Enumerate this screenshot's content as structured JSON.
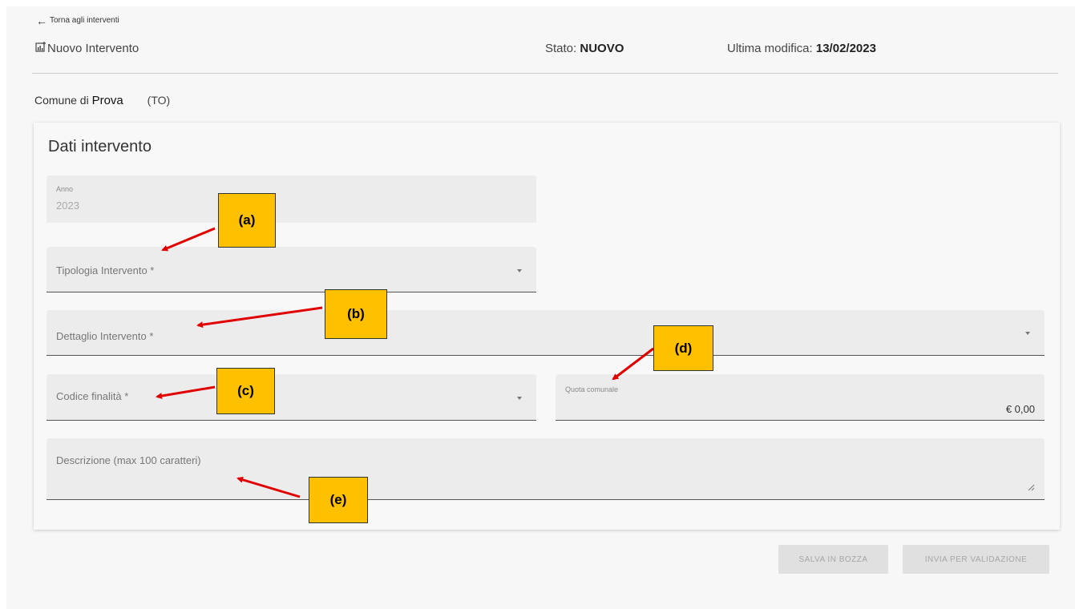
{
  "back_link": {
    "label": "Torna agli interventi"
  },
  "header": {
    "title": "Nuovo Intervento",
    "status_label": "Stato:",
    "status_value": "NUOVO",
    "last_mod_label": "Ultima modifica:",
    "last_mod_value": "13/02/2023"
  },
  "comune": {
    "prefix": "Comune di",
    "name": "Prova",
    "province": "(TO)"
  },
  "card": {
    "title": "Dati intervento"
  },
  "fields": {
    "anno": {
      "label": "Anno",
      "value": "2023"
    },
    "tipologia": {
      "label": "Tipologia Intervento *"
    },
    "dettaglio": {
      "label": "Dettaglio Intervento *"
    },
    "codice": {
      "label": "Codice finalità *"
    },
    "quota": {
      "label": "Quota comunale",
      "value": "€ 0,00"
    },
    "descrizione": {
      "label": "Descrizione (max 100 caratteri)"
    }
  },
  "buttons": {
    "save_draft": "SALVA IN BOZZA",
    "send_validation": "INVIA PER VALIDAZIONE"
  },
  "callouts": {
    "a": "(a)",
    "b": "(b)",
    "c": "(c)",
    "d": "(d)",
    "e": "(e)"
  },
  "colors": {
    "callout": "#ffc000",
    "arrow": "#e00000"
  }
}
